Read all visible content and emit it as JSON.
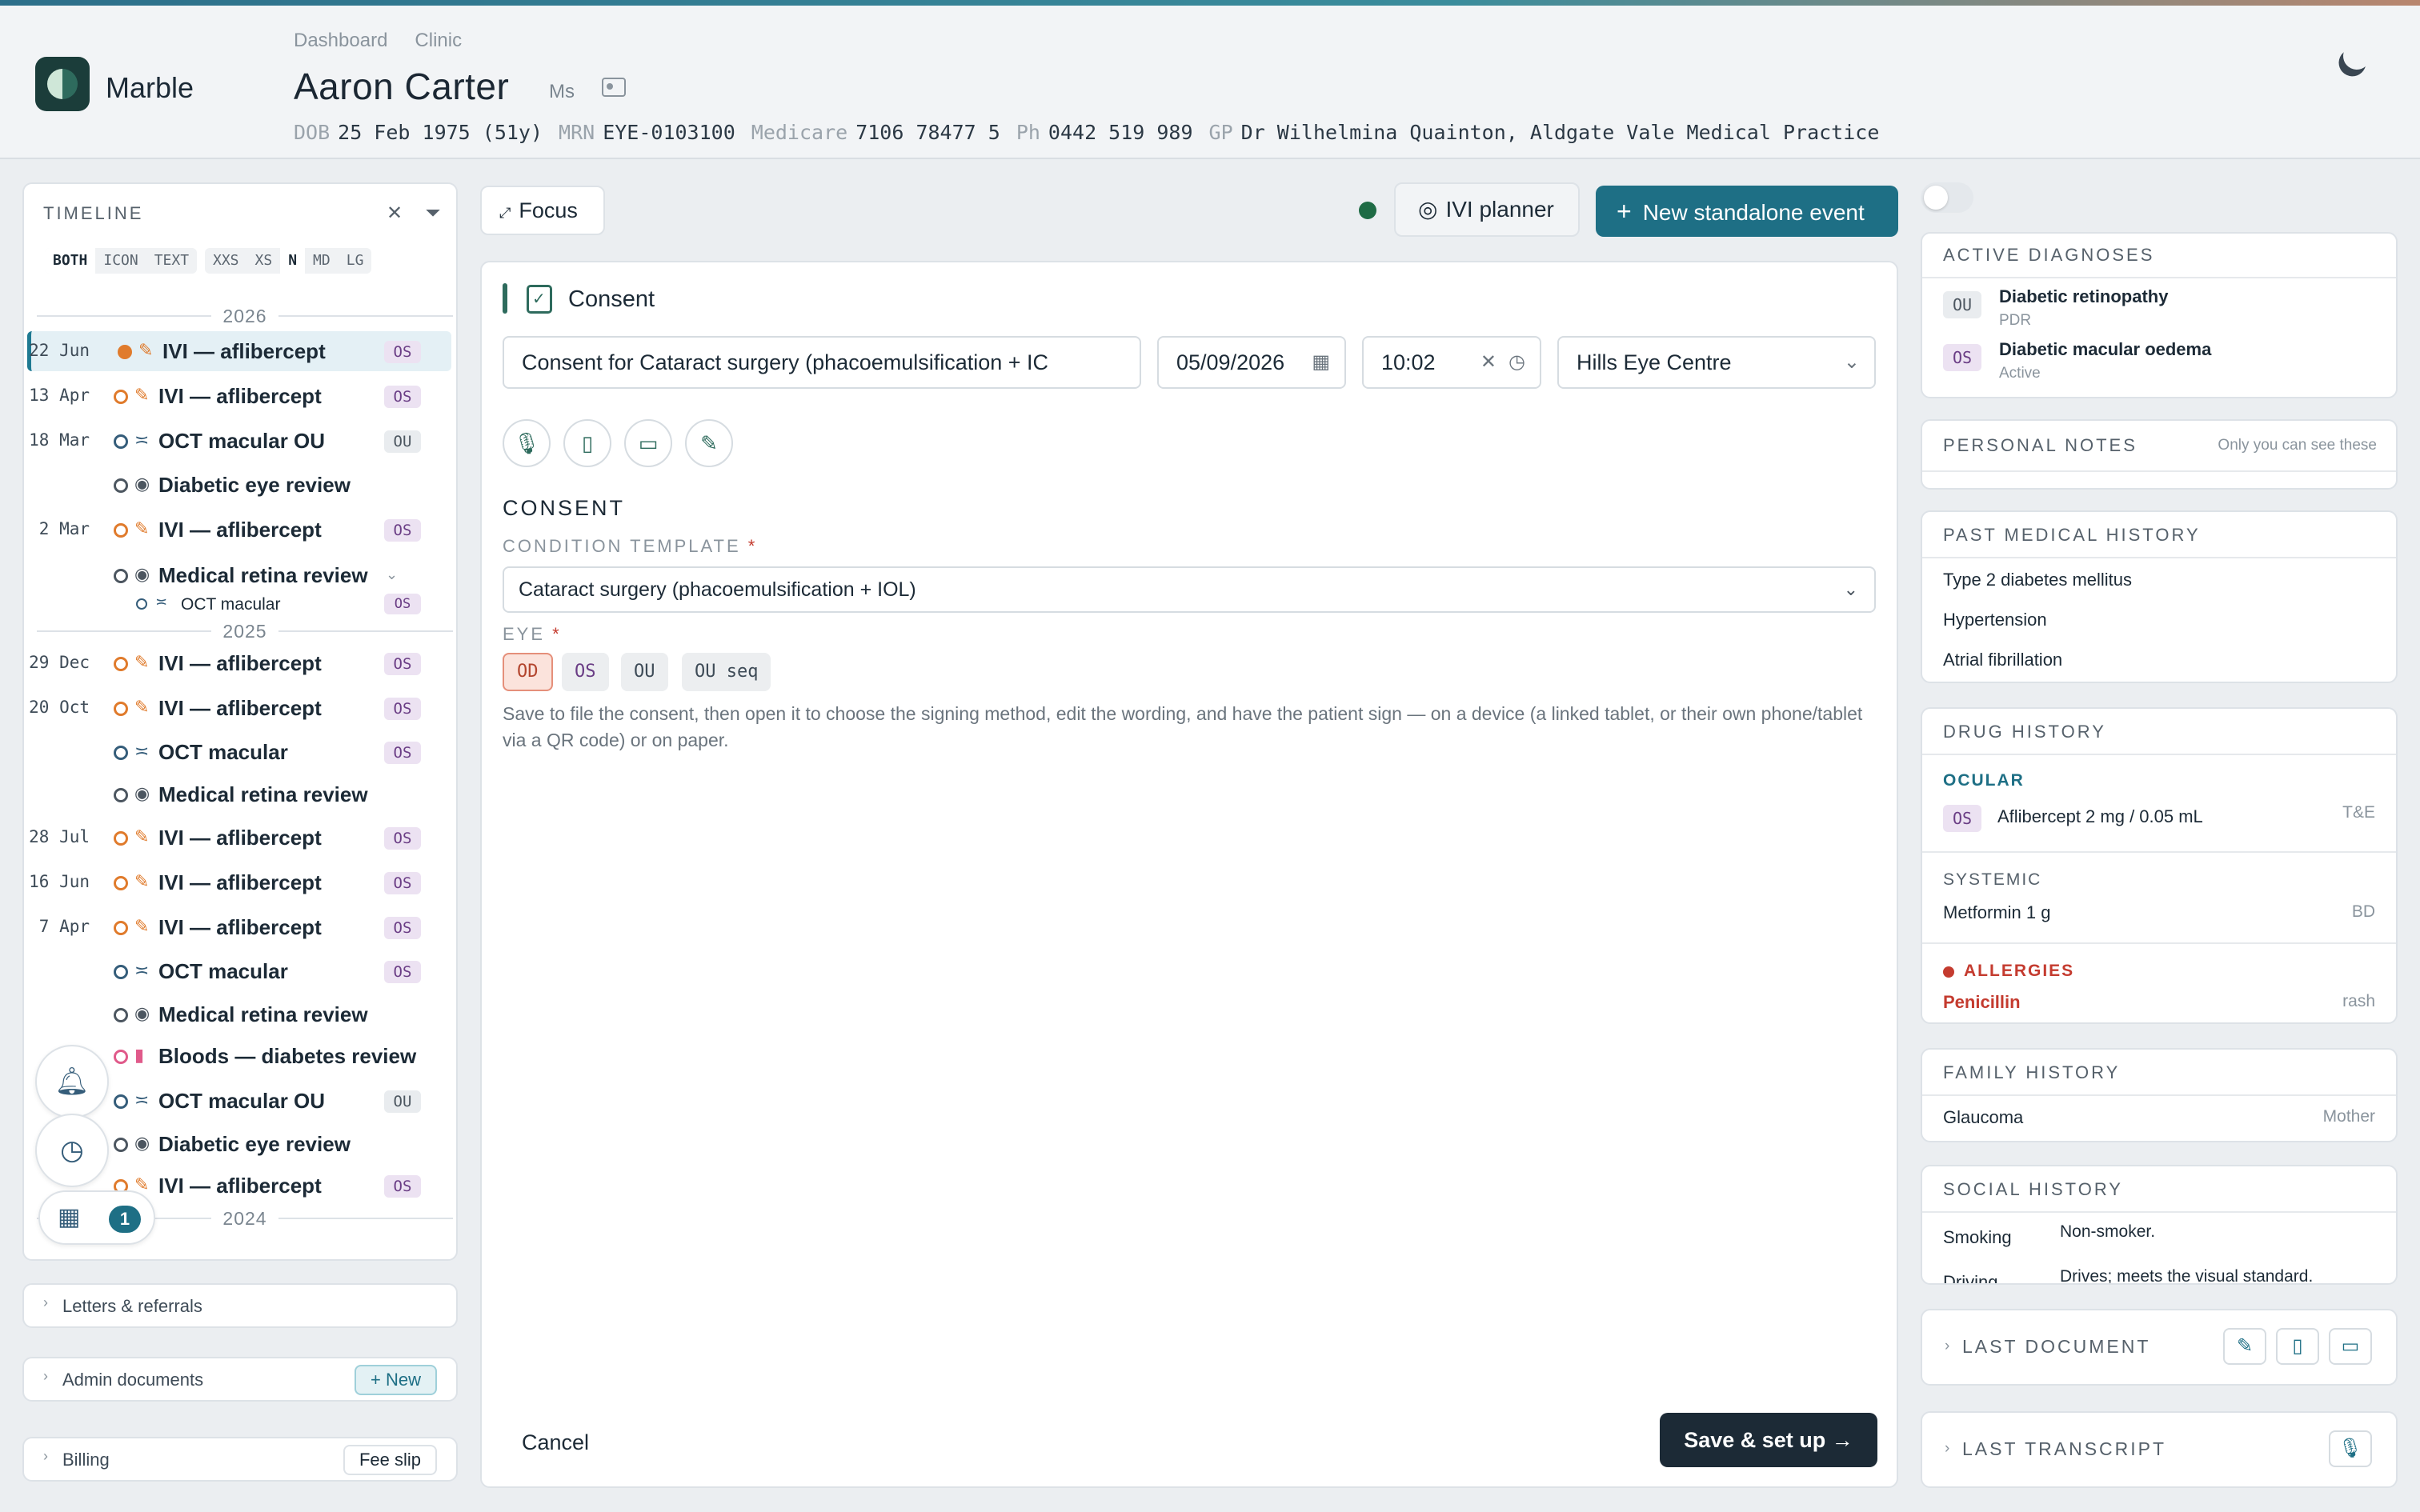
{
  "header": {
    "brand": "Marble",
    "breadcrumbs": [
      "Dashboard",
      "Clinic"
    ],
    "patient_name": "Aaron Carter",
    "patient_title": "Ms",
    "dob_label": "DOB",
    "dob": "25 Feb 1975 (51y)",
    "mrn_label": "MRN",
    "mrn": "EYE-0103100",
    "medicare_label": "Medicare",
    "medicare": "7106 78477 5",
    "ph_label": "Ph",
    "ph": "0442 519 989",
    "gp_label": "GP",
    "gp": "Dr Wilhelmina Quainton, Aldgate Vale Medical Practice"
  },
  "timeline": {
    "title": "TIMELINE",
    "view_modes": [
      "BOTH",
      "ICON",
      "TEXT"
    ],
    "sizes": [
      "XXS",
      "XS",
      "N",
      "MD",
      "LG"
    ],
    "years": [
      "2026",
      "2025",
      "2024"
    ],
    "rows": [
      {
        "date": "22 Jun",
        "label": "IVI — aflibercept",
        "eye": "OS"
      },
      {
        "date": "13 Apr",
        "label": "IVI — aflibercept",
        "eye": "OS"
      },
      {
        "date": "18 Mar",
        "label": "OCT macular OU",
        "eye": "OU"
      },
      {
        "date": "",
        "label": "Diabetic eye review",
        "eye": ""
      },
      {
        "date": "2 Mar",
        "label": "IVI — aflibercept",
        "eye": "OS"
      },
      {
        "date": "",
        "label": "Medical retina review",
        "eye": ""
      },
      {
        "date": "",
        "label": "OCT macular",
        "eye": "OS"
      },
      {
        "date": "29 Dec",
        "label": "IVI — aflibercept",
        "eye": "OS"
      },
      {
        "date": "20 Oct",
        "label": "IVI — aflibercept",
        "eye": "OS"
      },
      {
        "date": "",
        "label": "OCT macular",
        "eye": "OS"
      },
      {
        "date": "",
        "label": "Medical retina review",
        "eye": ""
      },
      {
        "date": "28 Jul",
        "label": "IVI — aflibercept",
        "eye": "OS"
      },
      {
        "date": "16 Jun",
        "label": "IVI — aflibercept",
        "eye": "OS"
      },
      {
        "date": "7 Apr",
        "label": "IVI — aflibercept",
        "eye": "OS"
      },
      {
        "date": "",
        "label": "OCT macular",
        "eye": "OS"
      },
      {
        "date": "",
        "label": "Medical retina review",
        "eye": ""
      },
      {
        "date": "",
        "label": "Bloods — diabetes review",
        "eye": ""
      },
      {
        "date": "",
        "label": "OCT macular OU",
        "eye": "OU"
      },
      {
        "date": "",
        "label": "Diabetic eye review",
        "eye": ""
      },
      {
        "date": "",
        "label": "IVI — aflibercept",
        "eye": "OS"
      }
    ],
    "calendar_count": "1"
  },
  "sections": {
    "letters": "Letters & referrals",
    "admin": "Admin documents",
    "admin_new": "+ New",
    "billing": "Billing",
    "fee_slip": "Fee slip"
  },
  "toolbar": {
    "focus": "Focus",
    "planner": "IVI planner",
    "new_event": "New standalone event"
  },
  "event": {
    "type": "Consent",
    "title_value": "Consent for Cataract surgery (phacoemulsification + IC",
    "date": "05/09/2026",
    "time": "10:02",
    "location": "Hills Eye Centre",
    "section_heading": "CONSENT",
    "template_label": "CONDITION TEMPLATE",
    "template_value": "Cataract surgery (phacoemulsification + IOL)",
    "eye_label": "EYE",
    "eye_options": [
      "OD",
      "OS",
      "OU",
      "OU seq"
    ],
    "eye_selected": "OD",
    "note": "Save to file the consent, then open it to choose the signing method, edit the wording, and have the patient sign — on a device (a linked tablet, or their own phone/tablet via a QR code) or on paper.",
    "cancel": "Cancel",
    "save": "Save & set up →"
  },
  "right": {
    "active_diagnoses": {
      "title": "ACTIVE DIAGNOSES",
      "items": [
        {
          "eye": "OU",
          "name": "Diabetic retinopathy",
          "status": "PDR"
        },
        {
          "eye": "OS",
          "name": "Diabetic macular oedema",
          "status": "Active"
        }
      ]
    },
    "personal_notes": {
      "title": "PERSONAL NOTES",
      "hint": "Only you can see these"
    },
    "pmh": {
      "title": "PAST MEDICAL HISTORY",
      "items": [
        "Type 2 diabetes mellitus",
        "Hypertension",
        "Atrial fibrillation"
      ]
    },
    "drugs": {
      "title": "DRUG HISTORY",
      "ocular_label": "OCULAR",
      "ocular": {
        "eye": "OS",
        "name": "Aflibercept 2 mg / 0.05 mL",
        "regimen": "T&E"
      },
      "systemic_label": "SYSTEMIC",
      "systemic": {
        "name": "Metformin 1 g",
        "regimen": "BD"
      },
      "allergies_label": "ALLERGIES",
      "allergy": {
        "name": "Penicillin",
        "reaction": "rash"
      }
    },
    "family": {
      "title": "FAMILY HISTORY",
      "item": "Glaucoma",
      "relation": "Mother"
    },
    "social": {
      "title": "SOCIAL HISTORY",
      "smoking_label": "Smoking",
      "smoking": "Non-smoker.",
      "driving_label": "Driving",
      "driving": "Drives; meets the visual standard."
    },
    "last_document": "LAST DOCUMENT",
    "last_transcript": "LAST TRANSCRIPT"
  },
  "colors": {
    "accent": "#1e6f85",
    "brand_green": "#2e6b5d",
    "ivi_orange": "#e07b2c",
    "os_purple": "#6a3d85",
    "allergy_red": "#c43b2f"
  }
}
